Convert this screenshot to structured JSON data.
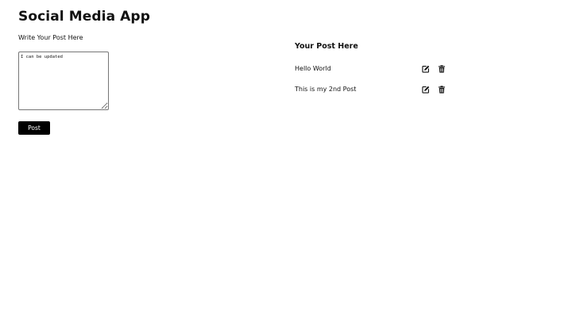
{
  "app": {
    "title": "Social Media App"
  },
  "compose": {
    "label": "Write Your Post Here",
    "textarea_value": "I can be updated",
    "post_button_label": "Post"
  },
  "posts": {
    "heading": "Your Post Here",
    "items": [
      {
        "text": "Hello World",
        "edit_icon": "edit-icon",
        "delete_icon": "trash-icon"
      },
      {
        "text": "This is my 2nd Post",
        "edit_icon": "edit-icon",
        "delete_icon": "trash-icon"
      }
    ]
  },
  "colors": {
    "button_bg": "#000000",
    "button_text": "#ffffff",
    "text": "#111111",
    "background": "#ffffff"
  }
}
